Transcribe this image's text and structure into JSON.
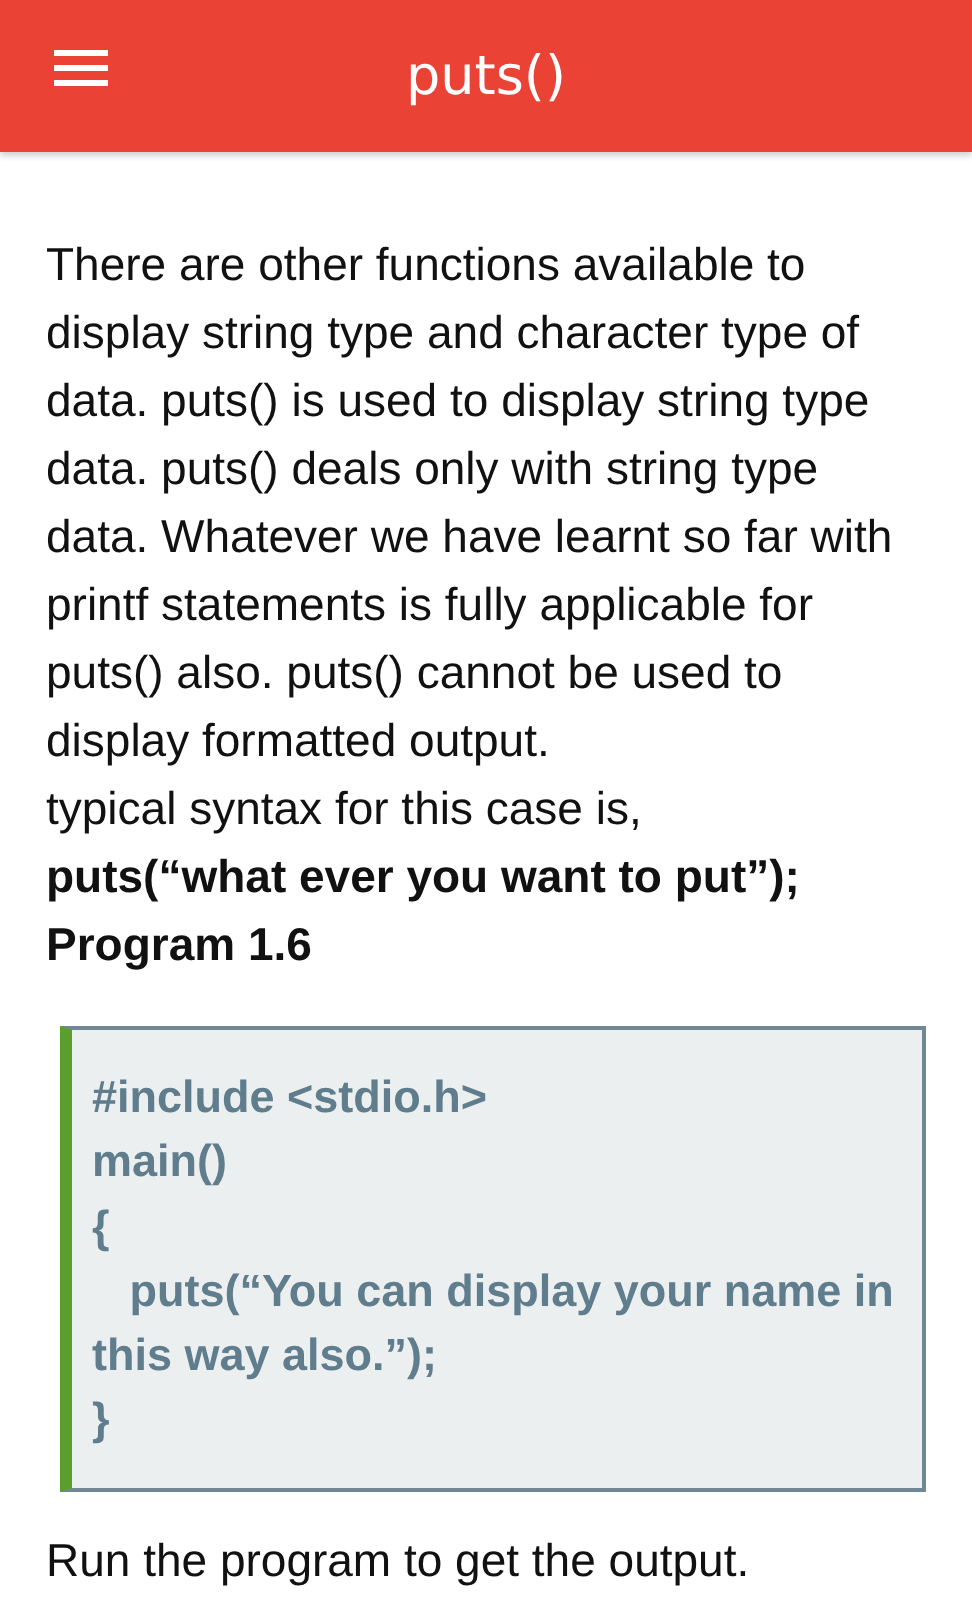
{
  "app_bar": {
    "title": "puts()"
  },
  "intro": [
    "There are other functions available to display string type and character type of data. puts() is used to display string type data. puts() deals only with string type data. Whatever we have learnt so far with printf statements is fully applicable for puts() also. puts() cannot be used to display formatted output.",
    "typical syntax for this case is,"
  ],
  "syntax": [
    "puts(“what ever you want to put”);",
    "Program 1.6"
  ],
  "code_lines": [
    "#include <stdio.h>",
    "main()",
    "{",
    "   puts(“You can display your name in this way also.”);",
    "}"
  ],
  "outro": [
    "Run the program to get the output."
  ]
}
